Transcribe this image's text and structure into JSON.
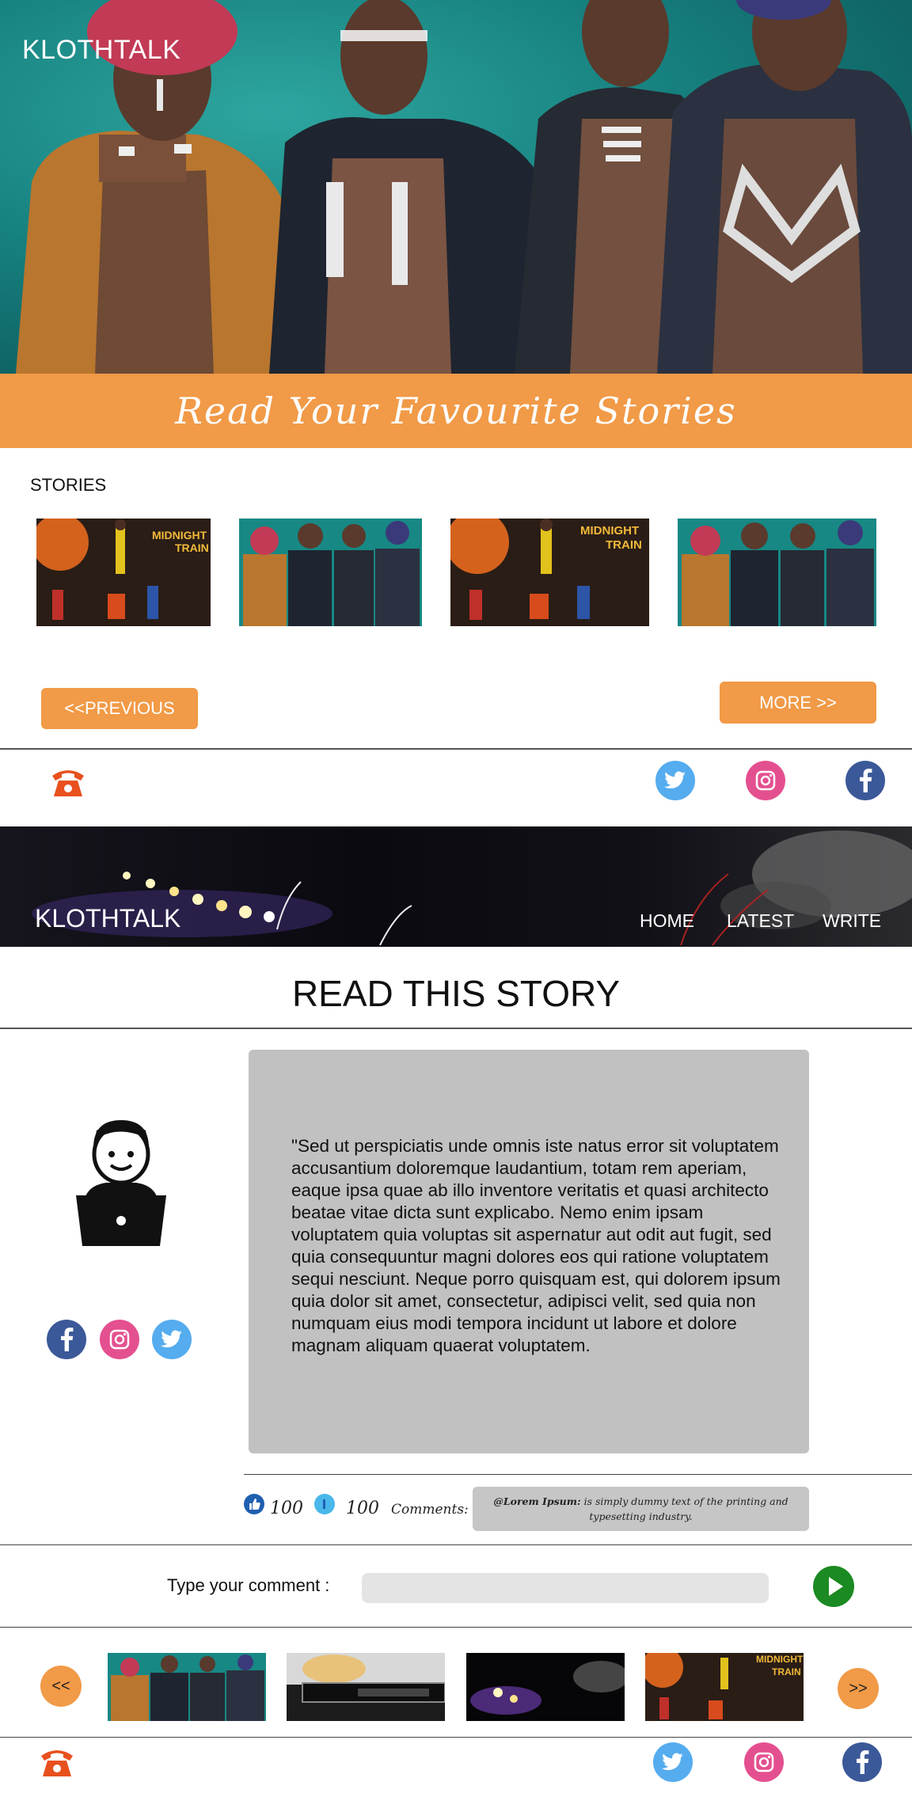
{
  "hero": {
    "brand": "KLOTHTALK"
  },
  "banner": {
    "text": "Read Your Favourite Stories"
  },
  "stories": {
    "section_label": "STORIES",
    "thumbnails": [
      "midnight-train-poster",
      "group-portrait-photo",
      "midnight-train-poster",
      "group-portrait-photo"
    ],
    "poster_title_line1": "MIDNIGHT",
    "poster_title_line2": "TRAIN",
    "previous_label": "<<PREVIOUS",
    "more_label": "MORE >>"
  },
  "story_header": {
    "brand": "KLOTHTALK",
    "nav": [
      "HOME",
      "LATEST",
      "WRITE"
    ]
  },
  "story": {
    "title": "READ THIS STORY",
    "text": "\"Sed ut perspiciatis unde omnis iste natus error sit voluptatem accusantium doloremque laudantium, totam rem aperiam, eaque ipsa quae ab illo inventore veritatis et quasi architecto beatae vitae dicta sunt explicabo. Nemo enim ipsam voluptatem quia voluptas sit aspernatur aut odit aut fugit, sed quia consequuntur magni dolores eos qui ratione voluptatem sequi nesciunt. Neque porro quisquam est, qui dolorem ipsum quia dolor sit amet, consectetur, adipisci velit, sed quia non numquam eius modi tempora incidunt ut labore et dolore magnam aliquam quaerat voluptatem.",
    "likes": "100",
    "dislikes": "100",
    "comments_label": "Comments:",
    "comment_author": "@Lorem Ipsum:",
    "comment_body": " is simply dummy text of the printing and typesetting industry."
  },
  "comment_form": {
    "label": "Type your comment :",
    "placeholder": ""
  },
  "carousel": {
    "prev_label": "<<",
    "next_label": ">>",
    "thumbnails": [
      "group-portrait-photo",
      "guitar-stage-photo",
      "concert-lights-photo",
      "midnight-train-poster"
    ]
  },
  "icons": {
    "phone": "phone-icon",
    "twitter": "twitter-icon",
    "instagram": "instagram-icon",
    "facebook": "facebook-icon",
    "user_laptop": "user-laptop-icon",
    "like": "thumbs-up-icon",
    "dislike": "thumbs-down-icon",
    "send": "play-send-icon"
  },
  "colors": {
    "accent_orange": "#f19a47",
    "teal": "#16807e",
    "twitter": "#55acee",
    "instagram": "#e4508f",
    "facebook": "#3b5998",
    "send_green": "#1b8a22",
    "story_box": "#c1c1c1",
    "phone_red": "#e8501e"
  }
}
